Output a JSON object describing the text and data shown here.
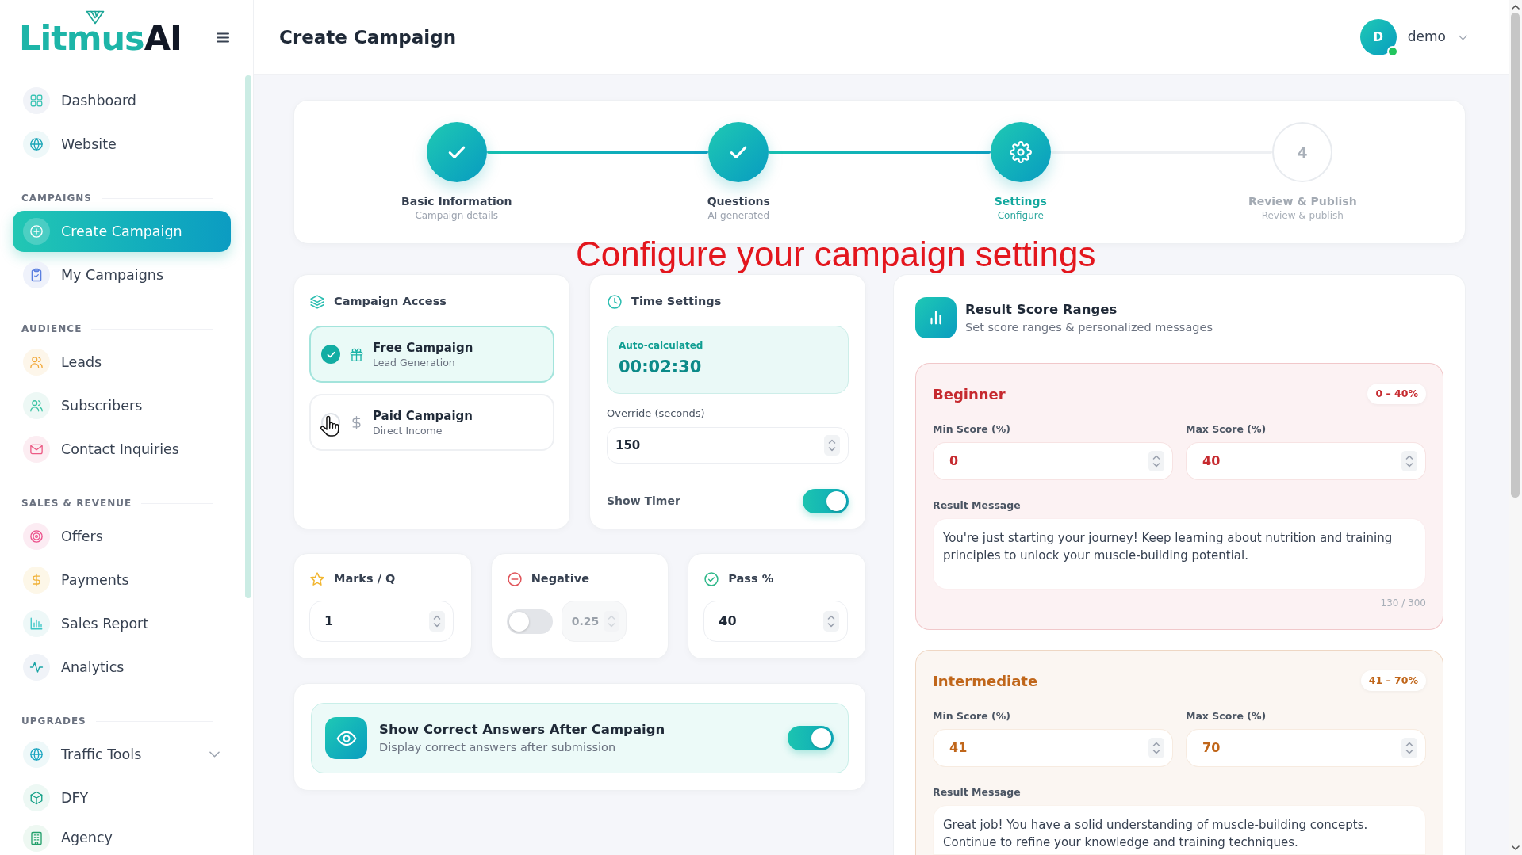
{
  "sidebar": {
    "logo": {
      "text": "Litmus",
      "accent": "AI"
    },
    "sections": [
      {
        "items": [
          {
            "label": "Dashboard",
            "kind": "link",
            "selected": false
          },
          {
            "label": "Website",
            "kind": "link",
            "selected": false
          }
        ]
      },
      {
        "heading": "CAMPAIGNS",
        "items": [
          {
            "label": "Create Campaign",
            "kind": "link",
            "selected": true
          },
          {
            "label": "My Campaigns",
            "kind": "link",
            "selected": false
          }
        ]
      },
      {
        "heading": "AUDIENCE",
        "items": [
          {
            "label": "Leads",
            "kind": "link",
            "selected": false
          },
          {
            "label": "Subscribers",
            "kind": "link",
            "selected": false
          },
          {
            "label": "Contact Inquiries",
            "kind": "link",
            "selected": false
          }
        ]
      },
      {
        "heading": "SALES & REVENUE",
        "items": [
          {
            "label": "Offers",
            "kind": "link",
            "selected": false
          },
          {
            "label": "Payments",
            "kind": "link",
            "selected": false
          },
          {
            "label": "Sales Report",
            "kind": "link",
            "selected": false
          },
          {
            "label": "Analytics",
            "kind": "link",
            "selected": false
          }
        ]
      },
      {
        "heading": "UPGRADES",
        "items": [
          {
            "label": "Traffic Tools",
            "kind": "group",
            "selected": false,
            "expanded": false
          },
          {
            "label": "DFY",
            "kind": "link",
            "selected": false
          },
          {
            "label": "Agency",
            "kind": "link",
            "selected": false
          }
        ]
      }
    ]
  },
  "header": {
    "title": "Create Campaign",
    "user": {
      "initial": "D",
      "name": "demo",
      "online": true
    }
  },
  "stepper": {
    "steps": [
      {
        "title": "Basic Information",
        "subtitle": "Campaign details",
        "done": true,
        "selected": false
      },
      {
        "title": "Questions",
        "subtitle": "AI generated",
        "done": true,
        "selected": false
      },
      {
        "title": "Settings",
        "subtitle": "Configure",
        "done": false,
        "selected": true
      },
      {
        "title": "Review & Publish",
        "subtitle": "Review & publish",
        "done": false,
        "selected": false,
        "number": "4"
      }
    ]
  },
  "caption": "Configure your campaign settings",
  "campaign_access": {
    "title": "Campaign Access",
    "options": [
      {
        "title": "Free Campaign",
        "subtitle": "Lead Generation",
        "selected": true
      },
      {
        "title": "Paid Campaign",
        "subtitle": "Direct Income",
        "selected": false
      }
    ]
  },
  "time_settings": {
    "title": "Time Settings",
    "auto_label": "Auto-calculated",
    "auto_value": "00:02:30",
    "override_label": "Override (seconds)",
    "override_value": "150",
    "show_timer": {
      "label": "Show Timer",
      "on": true
    }
  },
  "scoring": [
    {
      "kind": "number",
      "title": "Marks / Q",
      "value": "1"
    },
    {
      "kind": "toggle_number",
      "title": "Negative",
      "on": false,
      "value": "0.25"
    },
    {
      "kind": "number",
      "title": "Pass %",
      "value": "40"
    }
  ],
  "show_answers": {
    "title": "Show Correct Answers After Campaign",
    "description": "Display correct answers after submission",
    "on": true
  },
  "result_ranges": {
    "title": "Result Score Ranges",
    "subtitle": "Set score ranges & personalized messages",
    "ranges": [
      {
        "name": "Beginner",
        "color": "#c62a2f",
        "badge": "0 – 40%",
        "min_label": "Min Score (%)",
        "min_value": "0",
        "max_label": "Max Score (%)",
        "max_value": "40",
        "message_label": "Result Message",
        "message": "You're just starting your journey! Keep learning about nutrition and training principles to unlock your muscle-building potential.",
        "counter": "130 / 300"
      },
      {
        "name": "Intermediate",
        "color": "#c0661a",
        "badge": "41 – 70%",
        "min_label": "Min Score (%)",
        "min_value": "41",
        "max_label": "Max Score (%)",
        "max_value": "70",
        "message_label": "Result Message",
        "message": "Great job! You have a solid understanding of muscle-building concepts. Continue to refine your knowledge and training techniques."
      }
    ]
  }
}
